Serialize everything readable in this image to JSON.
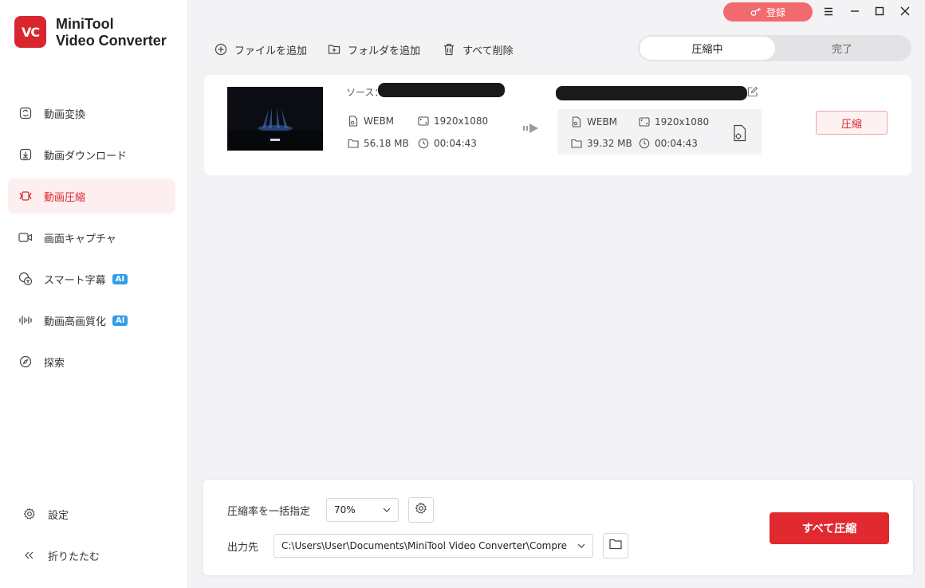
{
  "app": {
    "logo_text": "VC",
    "brand_line1": "MiniTool",
    "brand_line2": "Video Converter"
  },
  "titlebar": {
    "register_label": "登録"
  },
  "sidebar": {
    "items": [
      {
        "label": "動画変換",
        "icon": "convert-icon"
      },
      {
        "label": "動画ダウンロード",
        "icon": "download-icon"
      },
      {
        "label": "動画圧縮",
        "icon": "compress-icon",
        "active": true
      },
      {
        "label": "画面キャプチャ",
        "icon": "camera-icon"
      },
      {
        "label": "スマート字幕",
        "icon": "subtitle-icon",
        "badge": "AI"
      },
      {
        "label": "動画高画質化",
        "icon": "enhance-icon",
        "badge": "AI"
      },
      {
        "label": "探索",
        "icon": "compass-icon"
      }
    ],
    "settings_label": "設定",
    "collapse_label": "折りたたむ"
  },
  "toolbar": {
    "add_file": "ファイルを追加",
    "add_folder": "フォルダを追加",
    "delete_all": "すべて削除"
  },
  "tabs": {
    "active": "圧縮中",
    "other": "完了"
  },
  "file": {
    "source_label": "ソース：",
    "source": {
      "format": "WEBM",
      "resolution": "1920x1080",
      "size": "56.18 MB",
      "duration": "00:04:43"
    },
    "output": {
      "format": "WEBM",
      "resolution": "1920x1080",
      "size": "39.32 MB",
      "duration": "00:04:43"
    },
    "compress_label": "圧縮"
  },
  "bottom": {
    "ratio_label": "圧縮率を一括指定",
    "ratio_value": "70%",
    "output_label": "出力先",
    "output_path": "C:\\Users\\User\\Documents\\MiniTool Video Converter\\Compre",
    "compress_all": "すべて圧縮"
  },
  "colors": {
    "accent": "#d9262e",
    "register": "#f26a6e",
    "ai_badge": "#2f9ee8"
  }
}
